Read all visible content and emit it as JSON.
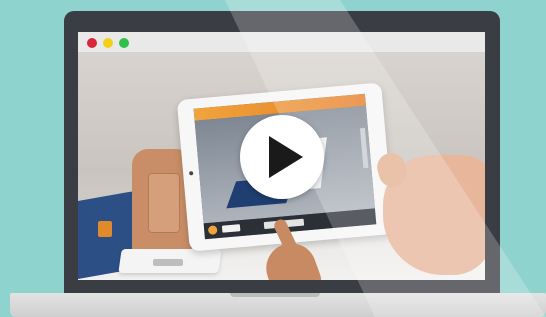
{
  "window": {
    "controls": [
      {
        "name": "close",
        "color": "#d9263b"
      },
      {
        "name": "minimize",
        "color": "#f3d01a"
      },
      {
        "name": "maximize",
        "color": "#2fbf4a"
      }
    ]
  },
  "video": {
    "play_icon": "play-icon"
  },
  "colors": {
    "background": "#8fd3cf",
    "laptop_frame": "#3a3d44",
    "app_accent": "#e67d26"
  }
}
